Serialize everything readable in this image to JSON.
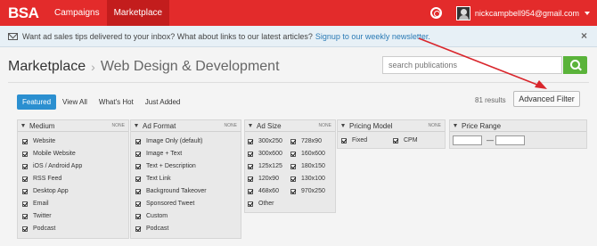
{
  "topbar": {
    "logo": "BSA",
    "nav": [
      "Campaigns",
      "Marketplace"
    ],
    "active_nav": "Marketplace",
    "user_email": "nickcampbell954@gmail.com",
    "brand_color": "#e32b2b"
  },
  "notice": {
    "text": "Want ad sales tips delivered to your inbox? What about links to our latest articles?",
    "link": "Signup to our weekly newsletter.",
    "close": "×"
  },
  "header": {
    "title": "Marketplace",
    "separator": "›",
    "subtitle": "Web Design & Development",
    "search_placeholder": "search publications"
  },
  "filters": {
    "tabs": [
      "Featured",
      "View All",
      "What's Hot",
      "Just Added"
    ],
    "active_tab": "Featured",
    "results": "81 results",
    "advanced_filter": "Advanced Filter"
  },
  "panels": {
    "medium": {
      "title": "Medium",
      "none": "NONE",
      "options": [
        "Website",
        "Mobile Website",
        "iOS / Android App",
        "RSS Feed",
        "Desktop App",
        "Email",
        "Twitter",
        "Podcast"
      ]
    },
    "ad_format": {
      "title": "Ad Format",
      "none": "NONE",
      "options": [
        "Image Only (default)",
        "Image + Text",
        "Text + Description",
        "Text Link",
        "Background Takeover",
        "Sponsored Tweet",
        "Custom",
        "Podcast"
      ]
    },
    "ad_size": {
      "title": "Ad Size",
      "none": "NONE",
      "col1": [
        "300x250",
        "300x600",
        "125x125",
        "120x90",
        "468x60",
        "Other"
      ],
      "col2": [
        "728x90",
        "160x600",
        "180x150",
        "130x100",
        "970x250"
      ]
    },
    "pricing": {
      "title": "Pricing Model",
      "none": "NONE",
      "options": [
        "Fixed",
        "CPM"
      ]
    },
    "price_range": {
      "title": "Price Range",
      "dash": "—"
    }
  }
}
